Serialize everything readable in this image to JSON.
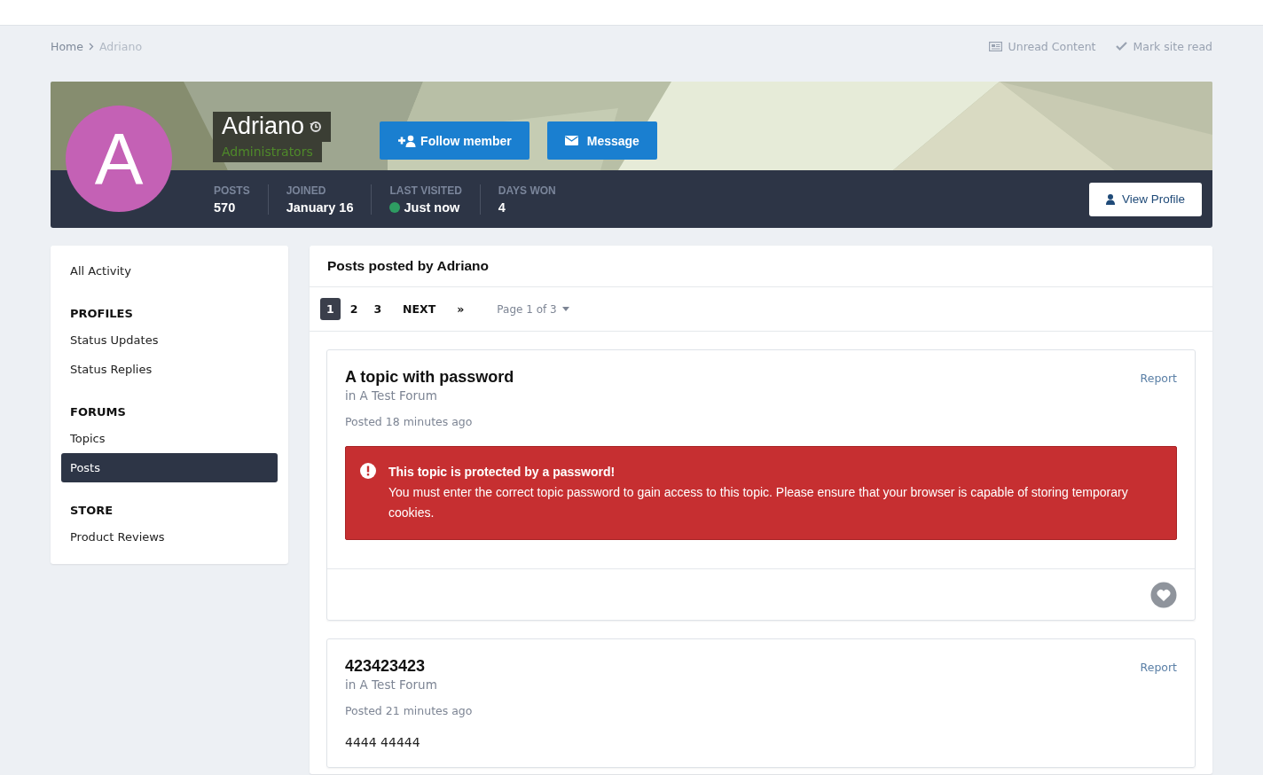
{
  "breadcrumb": [
    {
      "label": "Home"
    },
    {
      "label": "Adriano"
    }
  ],
  "top_links": [
    {
      "kind": "unread",
      "label": "Unread Content"
    },
    {
      "kind": "mark",
      "label": "Mark site read"
    }
  ],
  "profile": {
    "initial": "A",
    "name": "Adriano",
    "group": "Administrators",
    "follow_label": "Follow member",
    "message_label": "Message",
    "view_profile_label": "View Profile",
    "stats": [
      {
        "label": "POSTS",
        "value": "570",
        "online": false
      },
      {
        "label": "JOINED",
        "value": "January 16",
        "online": false
      },
      {
        "label": "LAST VISITED",
        "value": "Just now",
        "online": true
      },
      {
        "label": "DAYS WON",
        "value": "4",
        "online": false
      }
    ]
  },
  "sidebar": {
    "top": [
      {
        "label": "All Activity",
        "selected": false
      }
    ],
    "sections": [
      {
        "title": "PROFILES",
        "items": [
          {
            "label": "Status Updates",
            "selected": false
          },
          {
            "label": "Status Replies",
            "selected": false
          }
        ]
      },
      {
        "title": "FORUMS",
        "items": [
          {
            "label": "Topics",
            "selected": false
          },
          {
            "label": "Posts",
            "selected": true
          }
        ]
      },
      {
        "title": "STORE",
        "items": [
          {
            "label": "Product Reviews",
            "selected": false
          }
        ]
      }
    ]
  },
  "main": {
    "title": "Posts posted by Adriano",
    "pagination": {
      "pages": [
        {
          "label": "1",
          "selected": true
        },
        {
          "label": "2",
          "selected": false
        },
        {
          "label": "3",
          "selected": false
        }
      ],
      "next": "NEXT",
      "last": "»",
      "page_jump": "Page 1 of 3"
    },
    "posts": [
      {
        "kind": "protected",
        "title": "A topic with password",
        "forum": "in A Test Forum",
        "posted": "Posted 18 minutes ago",
        "report": "Report",
        "alert_title": "This topic is protected by a password!",
        "alert_text": "You must enter the correct topic password to gain access to this topic. Please ensure that your browser is capable of storing temporary cookies."
      },
      {
        "kind": "text",
        "title": "423423423",
        "forum": "in A Test Forum",
        "posted": "Posted 21 minutes ago",
        "report": "Report",
        "body": "4444 44444"
      }
    ]
  }
}
